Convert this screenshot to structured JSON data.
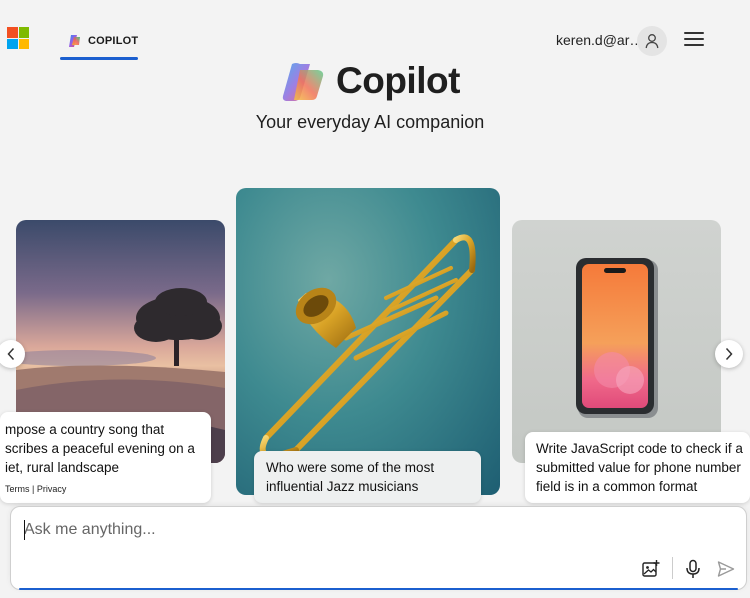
{
  "header": {
    "tab_label": "COPILOT",
    "account": "keren.d@ar…",
    "brand_colors": [
      "#f25022",
      "#7fba00",
      "#00a4ef",
      "#ffb900"
    ],
    "accent": "#1b5fcf"
  },
  "hero": {
    "title": "Copilot",
    "subtitle": "Your everyday AI companion"
  },
  "cards": {
    "left": {
      "lines": [
        "mpose a country song that",
        "scribes a peaceful evening on a",
        "iet, rural landscape"
      ],
      "legal": "Terms | Privacy"
    },
    "middle": {
      "text": "Who were some of the most influential Jazz musicians"
    },
    "right": {
      "lines": [
        "Write JavaScript code to check if a",
        "submitted value for phone number",
        "field is in a common format"
      ]
    }
  },
  "input": {
    "placeholder": "Ask me anything..."
  },
  "icons": [
    "microsoft-logo",
    "copilot-icon",
    "user-icon",
    "hamburger-menu-icon",
    "chevron-left-icon",
    "chevron-right-icon",
    "image-add-icon",
    "microphone-icon",
    "send-icon"
  ]
}
